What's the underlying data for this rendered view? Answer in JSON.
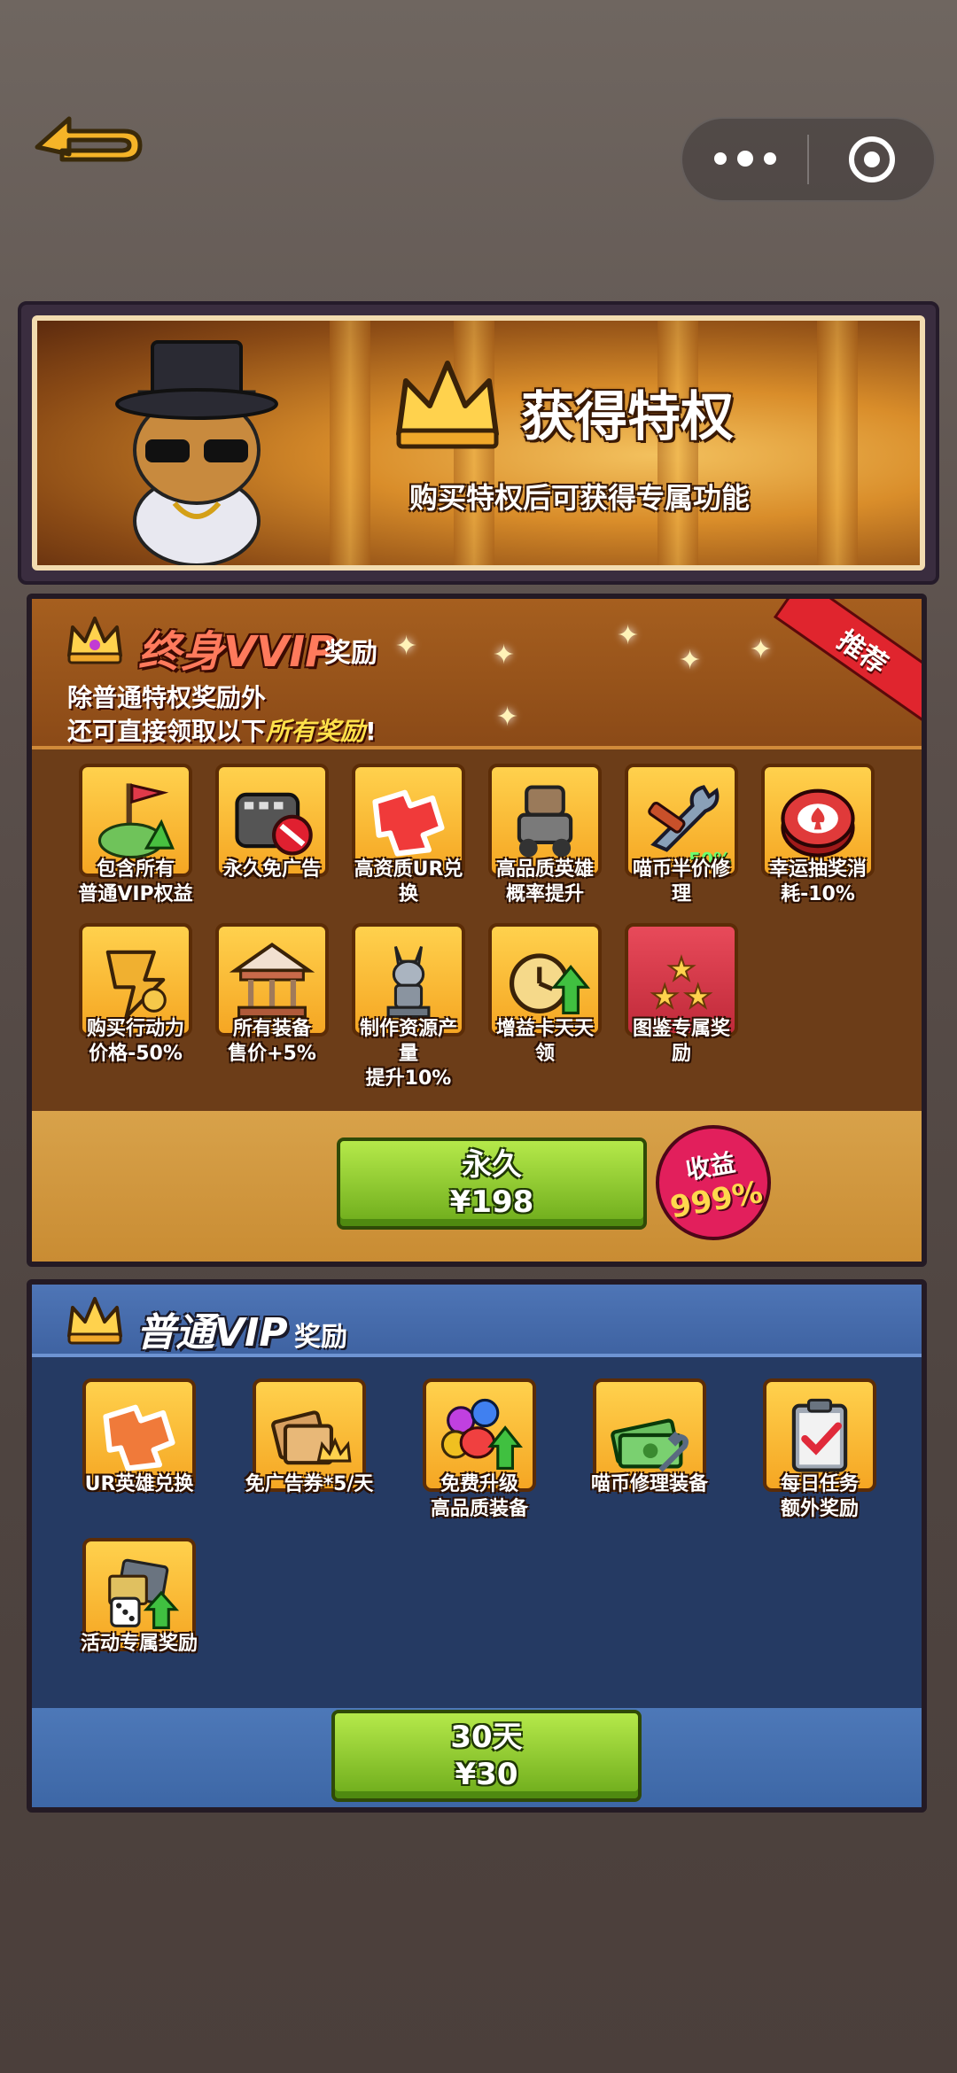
{
  "banner": {
    "title": "获得特权",
    "subtitle": "购买特权后可获得专属功能"
  },
  "vvip": {
    "title": "终身VVIP",
    "title_suffix": "奖励",
    "desc_line1": "除普通特权奖励外",
    "desc_line2_prefix": "还可直接领取以下",
    "desc_line2_highlight": "所有奖励",
    "desc_line2_suffix": "!",
    "ribbon": "推荐",
    "items": [
      {
        "label": "包含所有\n普通VIP权益",
        "icon": "castle-flag-icon"
      },
      {
        "label": "永久免广告",
        "icon": "no-ads-film-icon"
      },
      {
        "label": "高资质UR兑\n换",
        "icon": "ur-puzzle-icon"
      },
      {
        "label": "高品质英雄\n概率提升",
        "icon": "robot-hero-icon"
      },
      {
        "label": "喵币半价修\n理",
        "icon": "wrench-icon",
        "badge": "-50%"
      },
      {
        "label": "幸运抽奖消\n耗-10%",
        "icon": "poker-chip-icon"
      },
      {
        "label": "购买行动力\n价格-50%",
        "icon": "running-energy-icon"
      },
      {
        "label": "所有装备\n售价+5%",
        "icon": "carousel-icon"
      },
      {
        "label": "制作资源产\n量\n提升10%",
        "icon": "statue-icon"
      },
      {
        "label": "增益卡天天\n领",
        "icon": "clock-arrow-icon"
      },
      {
        "label": "图鉴专属奖\n励",
        "icon": "star-card-icon"
      }
    ],
    "button_line1": "永久",
    "button_line2": "¥198",
    "profit_label": "收益",
    "profit_value": "999%"
  },
  "vip": {
    "title": "普通VIP",
    "title_suffix": "奖励",
    "items": [
      {
        "label": "UR英雄兑换",
        "icon": "ur-puzzle-icon"
      },
      {
        "label": "免广告券*5/天",
        "icon": "ticket-crown-icon"
      },
      {
        "label": "免费升级\n高品质装备",
        "icon": "paw-upgrade-icon"
      },
      {
        "label": "喵币修理装备",
        "icon": "money-wrench-icon"
      },
      {
        "label": "每日任务\n额外奖励",
        "icon": "clipboard-check-icon"
      },
      {
        "label": "活动专属奖励",
        "icon": "dice-cards-icon"
      }
    ],
    "button_line1": "30天",
    "button_line2": "¥30"
  },
  "colors": {
    "vvip_bg": "#6c3d18",
    "vip_bg": "#253a63",
    "tile": "#f5a623",
    "button_green": "#8cc63f",
    "profit_pink": "#e21f5c"
  }
}
